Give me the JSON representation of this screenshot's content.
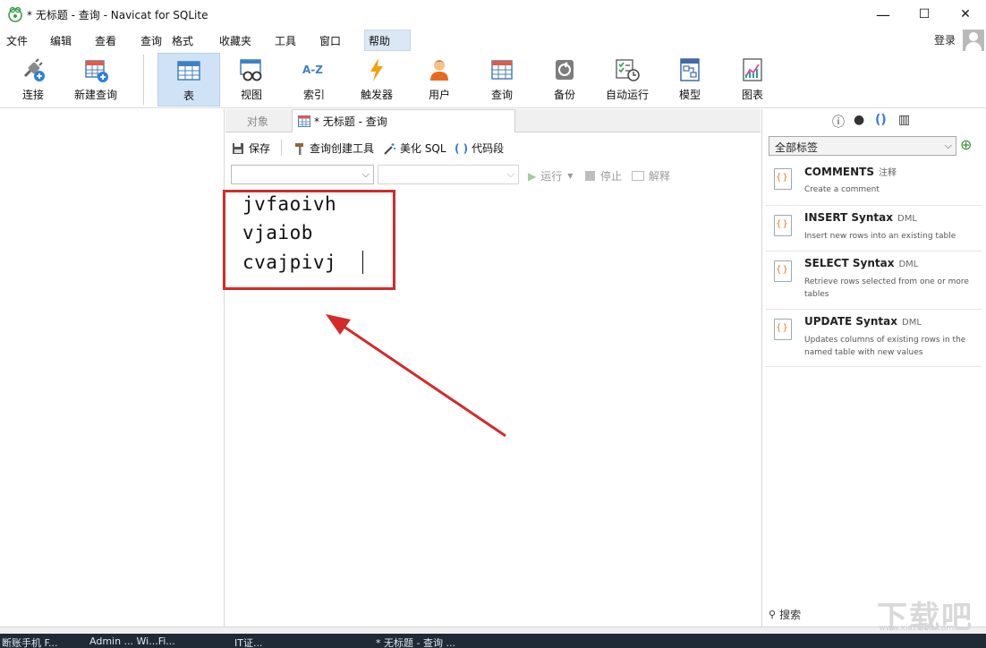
{
  "window": {
    "title": "* 无标题 - 查询 - Navicat for SQLite",
    "min": "—",
    "max": "☐",
    "close": "✕"
  },
  "menu": {
    "items": [
      "文件",
      "编辑",
      "查看",
      "查询",
      "格式",
      "收藏夹",
      "工具",
      "窗口",
      "帮助"
    ],
    "login": "登录"
  },
  "toolbar": {
    "buttons": [
      "连接",
      "新建查询",
      "表",
      "视图",
      "索引",
      "触发器",
      "用户",
      "查询",
      "备份",
      "自动运行",
      "模型",
      "图表"
    ],
    "active": "表"
  },
  "tabs": {
    "objects": "对象",
    "query": "* 无标题 - 查询"
  },
  "query_toolbar": {
    "save": "保存",
    "builder": "查询创建工具",
    "beautify": "美化 SQL",
    "snippet": "代码段"
  },
  "run_bar": {
    "run": "运行",
    "stop": "停止",
    "explain": "解释"
  },
  "editor": {
    "lines": [
      "jvfaoivh",
      "vjaiob",
      "cvajpivj"
    ]
  },
  "right_panel": {
    "filter": "全部标签",
    "snippets": [
      {
        "title": "COMMENTS",
        "tag": "注释",
        "desc": "Create a comment"
      },
      {
        "title": "INSERT Syntax",
        "tag": "DML",
        "desc": "Insert new rows into an existing table"
      },
      {
        "title": "SELECT Syntax",
        "tag": "DML",
        "desc": "Retrieve rows selected from one or more tables"
      },
      {
        "title": "UPDATE Syntax",
        "tag": "DML",
        "desc": "Updates columns of existing rows in the named table with new values"
      }
    ],
    "search": "搜索"
  },
  "taskbar": {
    "items": [
      "断账手机 F...",
      "Admin ... Wi...Fi...",
      "IT证...",
      "* 无标题 - 查询 ..."
    ]
  },
  "watermark": {
    "main": "下载吧",
    "sub": "www.xiazaiba.com"
  },
  "colors": {
    "accent": "#cfe2f6",
    "highlight": "#d42a2a"
  }
}
